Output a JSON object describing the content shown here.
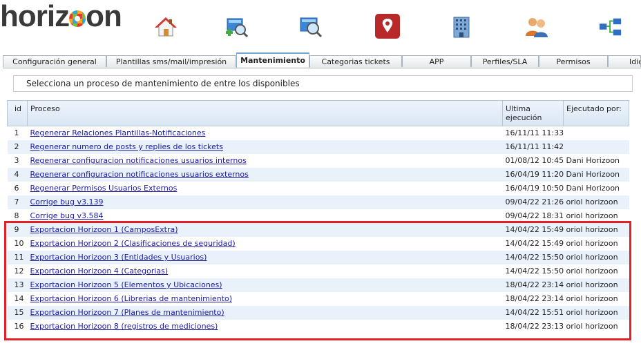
{
  "header": {
    "logo_text_pre": "horiz",
    "logo_text_post": "on",
    "toolbar_icons": [
      "home-icon",
      "search-add-icon",
      "search-doc-icon",
      "map-pin-icon",
      "building-icon",
      "users-icon",
      "network-icon"
    ]
  },
  "tabs": [
    {
      "label": "Configuración general",
      "active": false
    },
    {
      "label": "Plantillas sms/mail/impresión",
      "active": false
    },
    {
      "label": "Mantenimiento",
      "active": true
    },
    {
      "label": "Categorias tickets",
      "active": false
    },
    {
      "label": "APP",
      "active": false
    },
    {
      "label": "Perfiles/SLA",
      "active": false
    },
    {
      "label": "Permisos",
      "active": false
    },
    {
      "label": "Idio",
      "active": false
    }
  ],
  "info": {
    "text": "Selecciona un proceso de mantenimiento de entre los disponibles"
  },
  "table": {
    "headers": {
      "id": "id",
      "proceso": "Proceso",
      "ultima": "Ultima ejecución",
      "ejecutado": "Ejecutado por:"
    },
    "rows": [
      {
        "id": "1",
        "proceso": "Regenerar Relaciones Plantillas-Notificaciones",
        "ultima": "16/11/11 11:33",
        "ejecutado": ""
      },
      {
        "id": "2",
        "proceso": "Regenerar numero de posts y replies de los tickets",
        "ultima": "16/11/11 11:42",
        "ejecutado": ""
      },
      {
        "id": "3",
        "proceso": "Regenerar configuracion notificaciones usuarios internos",
        "ultima": "01/08/12 10:45",
        "ejecutado": "Dani Horizoon"
      },
      {
        "id": "4",
        "proceso": "Regenerar configuracion notificaciones usuarios externos",
        "ultima": "16/04/19 11:20",
        "ejecutado": "Dani Horizoon"
      },
      {
        "id": "6",
        "proceso": "Regenerar Permisos Usuarios Externos",
        "ultima": "16/04/19 10:50",
        "ejecutado": "Dani Horizoon"
      },
      {
        "id": "7",
        "proceso": "Corrige bug v3.139",
        "ultima": "09/04/22 21:26",
        "ejecutado": "oriol horizoon"
      },
      {
        "id": "8",
        "proceso": "Corrige bug v3.584",
        "ultima": "09/04/22 18:31",
        "ejecutado": "oriol horizoon"
      },
      {
        "id": "9",
        "proceso": "Exportacion Horizoon 1 (CamposExtra)",
        "ultima": "14/04/22 15:49",
        "ejecutado": "oriol horizoon"
      },
      {
        "id": "10",
        "proceso": "Exportacion Horizoon 2 (Clasificaciones de seguridad)",
        "ultima": "14/04/22 15:49",
        "ejecutado": "oriol horizoon"
      },
      {
        "id": "11",
        "proceso": "Exportacion Horizoon 3 (Entidades y Usuarios)",
        "ultima": "14/04/22 15:50",
        "ejecutado": "oriol horizoon"
      },
      {
        "id": "12",
        "proceso": "Exportacion Horizoon 4 (Categorias)",
        "ultima": "14/04/22 15:50",
        "ejecutado": "oriol horizoon"
      },
      {
        "id": "13",
        "proceso": "Exportacion Horizoon 5 (Elementos y Ubicaciones)",
        "ultima": "18/04/22 23:14",
        "ejecutado": "oriol horizoon"
      },
      {
        "id": "14",
        "proceso": "Exportacion Horizoon 6 (Librerias de mantenimiento)",
        "ultima": "18/04/22 23:14",
        "ejecutado": "oriol horizoon"
      },
      {
        "id": "15",
        "proceso": "Exportacion Horizoon 7 (Planes de mantenimiento)",
        "ultima": "14/04/22 15:51",
        "ejecutado": "oriol horizoon"
      },
      {
        "id": "16",
        "proceso": "Exportacion Horizoon 8 (registros de mediciones)",
        "ultima": "18/04/22 23:13",
        "ejecutado": "oriol horizoon"
      }
    ]
  },
  "colors": {
    "highlight": "#e3202a",
    "link": "#1a1aa6",
    "row_alt": "#e9f1fb",
    "accent_tab": "#6fa3d2"
  }
}
